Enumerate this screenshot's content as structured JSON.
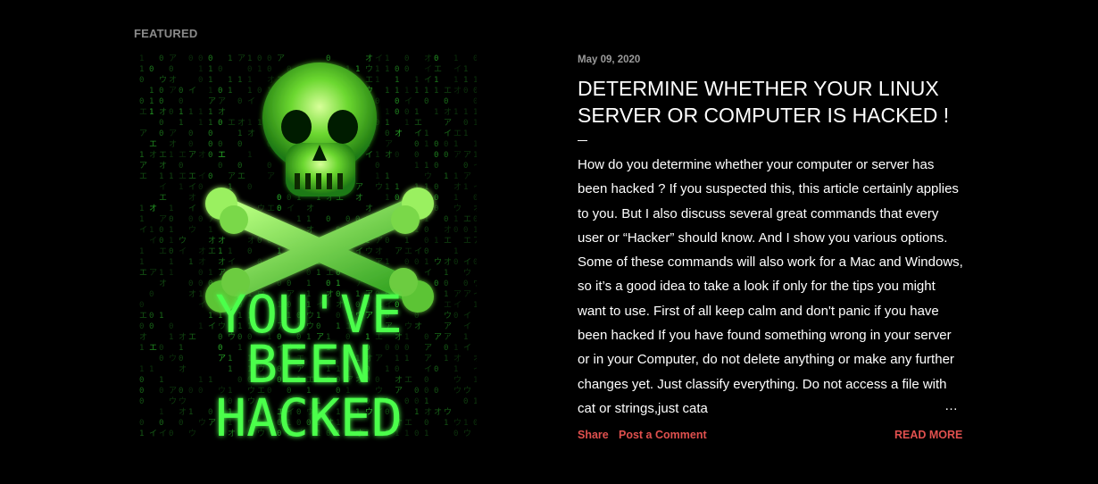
{
  "section": {
    "label": "FEATURED"
  },
  "post": {
    "image_text": [
      "YOU'VE",
      "BEEN",
      "HACKED"
    ],
    "date": "May 09, 2020",
    "title": "DETERMINE WHETHER YOUR LINUX SERVER OR COMPUTER IS HACKED !",
    "snippet": "How do you determine whether your computer or server has been hacked ? If you suspected this, this article certainly applies to you. But I also discuss several great commands that every user or “Hacker” should know. And I show you various options. Some of these commands will also work for a Mac and Windows, so it’s a good idea to take a look if only for the tips you might want to use. First of all keep calm and don't panic if you have been hacked If you have found something wrong in your server or in your Computer, do not delete anything or make any further changes yet. Just classify everything. Do not access a file with cat or strings,just cata",
    "ellipsis": "…",
    "share_label": "Share",
    "comment_label": "Post a Comment",
    "read_more_label": "READ MORE"
  },
  "colors": {
    "background": "#000000",
    "link": "#e0504e",
    "matrix_green": "#3cff3c"
  }
}
